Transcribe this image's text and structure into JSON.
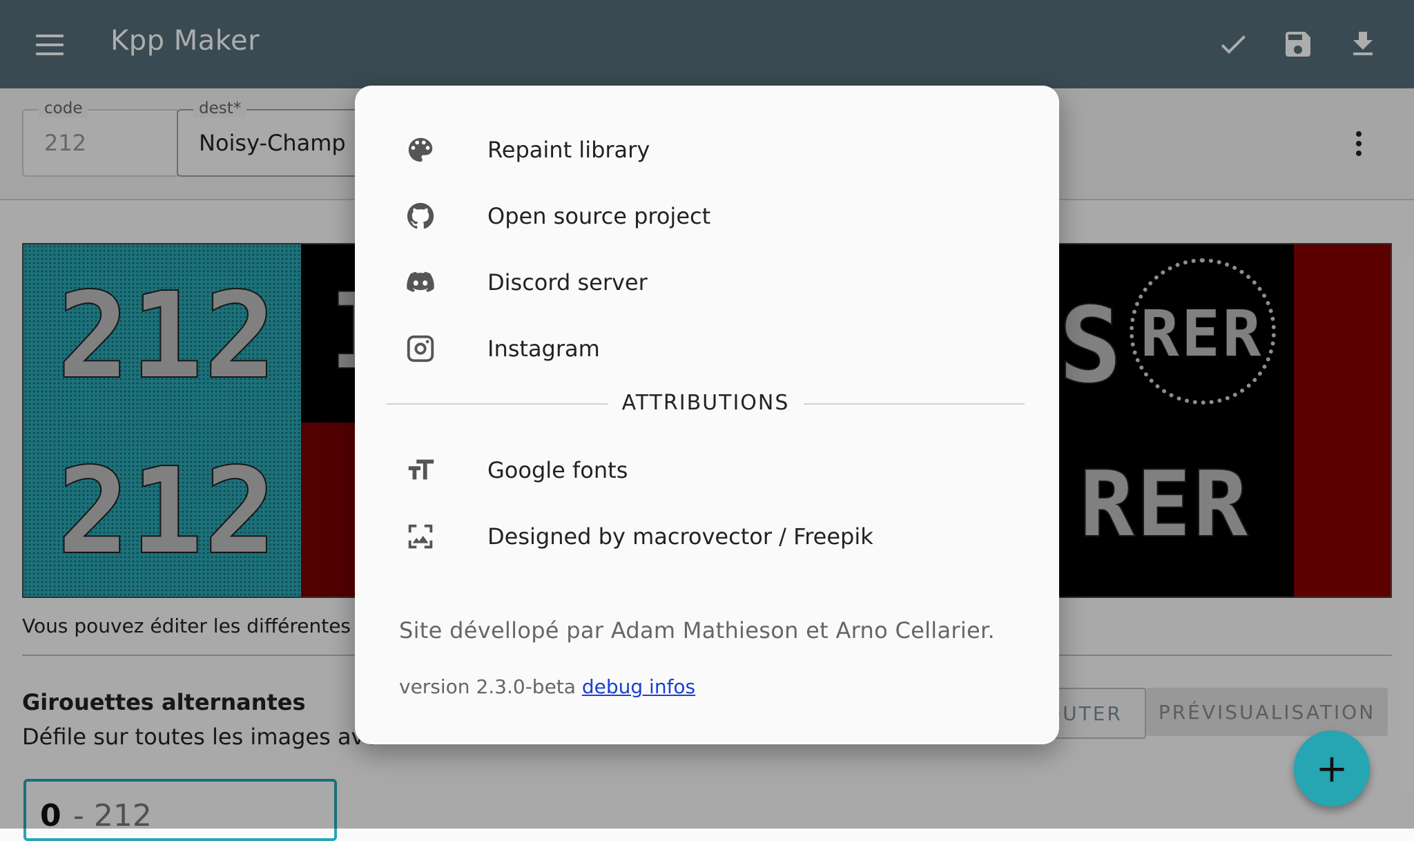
{
  "app": {
    "title": "Kpp Maker",
    "actions": [
      "check-icon",
      "save-icon",
      "download-icon"
    ]
  },
  "form": {
    "code_label": "code",
    "code_value": "212",
    "dest_label": "dest*",
    "dest_value": "Noisy-Champ"
  },
  "preview": {
    "route_top": "212",
    "route_bottom": "212",
    "rer_circle": "RER",
    "rer_bottom": "RER",
    "fragment_letter": "S",
    "fragment_bar": "I",
    "colors": {
      "cyan": "#2aa8b5",
      "red": "#8a0000",
      "black": "#000000"
    }
  },
  "page": {
    "caption": "Vous pouvez éditer les différentes po",
    "section_title": "Girouettes alternantes",
    "section_sub": "Défile sur toutes les images ave",
    "add_button": "OUTER",
    "preview_button": "PRÉVISUALISATION",
    "fab_label": "+",
    "frame_index": "0",
    "frame_sep": "-",
    "frame_code": "212"
  },
  "dialog": {
    "items": [
      {
        "icon": "palette-icon",
        "label": "Repaint library"
      },
      {
        "icon": "github-icon",
        "label": "Open source project"
      },
      {
        "icon": "discord-icon",
        "label": "Discord server"
      },
      {
        "icon": "instagram-icon",
        "label": "Instagram"
      }
    ],
    "attributions_heading": "ATTRIBUTIONS",
    "attributions": [
      {
        "icon": "font-size-icon",
        "label": "Google fonts"
      },
      {
        "icon": "image-icon",
        "label": "Designed by macrovector / Freepik"
      }
    ],
    "credit": "Site dévellopé par Adam Mathieson et Arno Cellarier.",
    "version": "version 2.3.0-beta",
    "debug_link": "debug infos"
  }
}
